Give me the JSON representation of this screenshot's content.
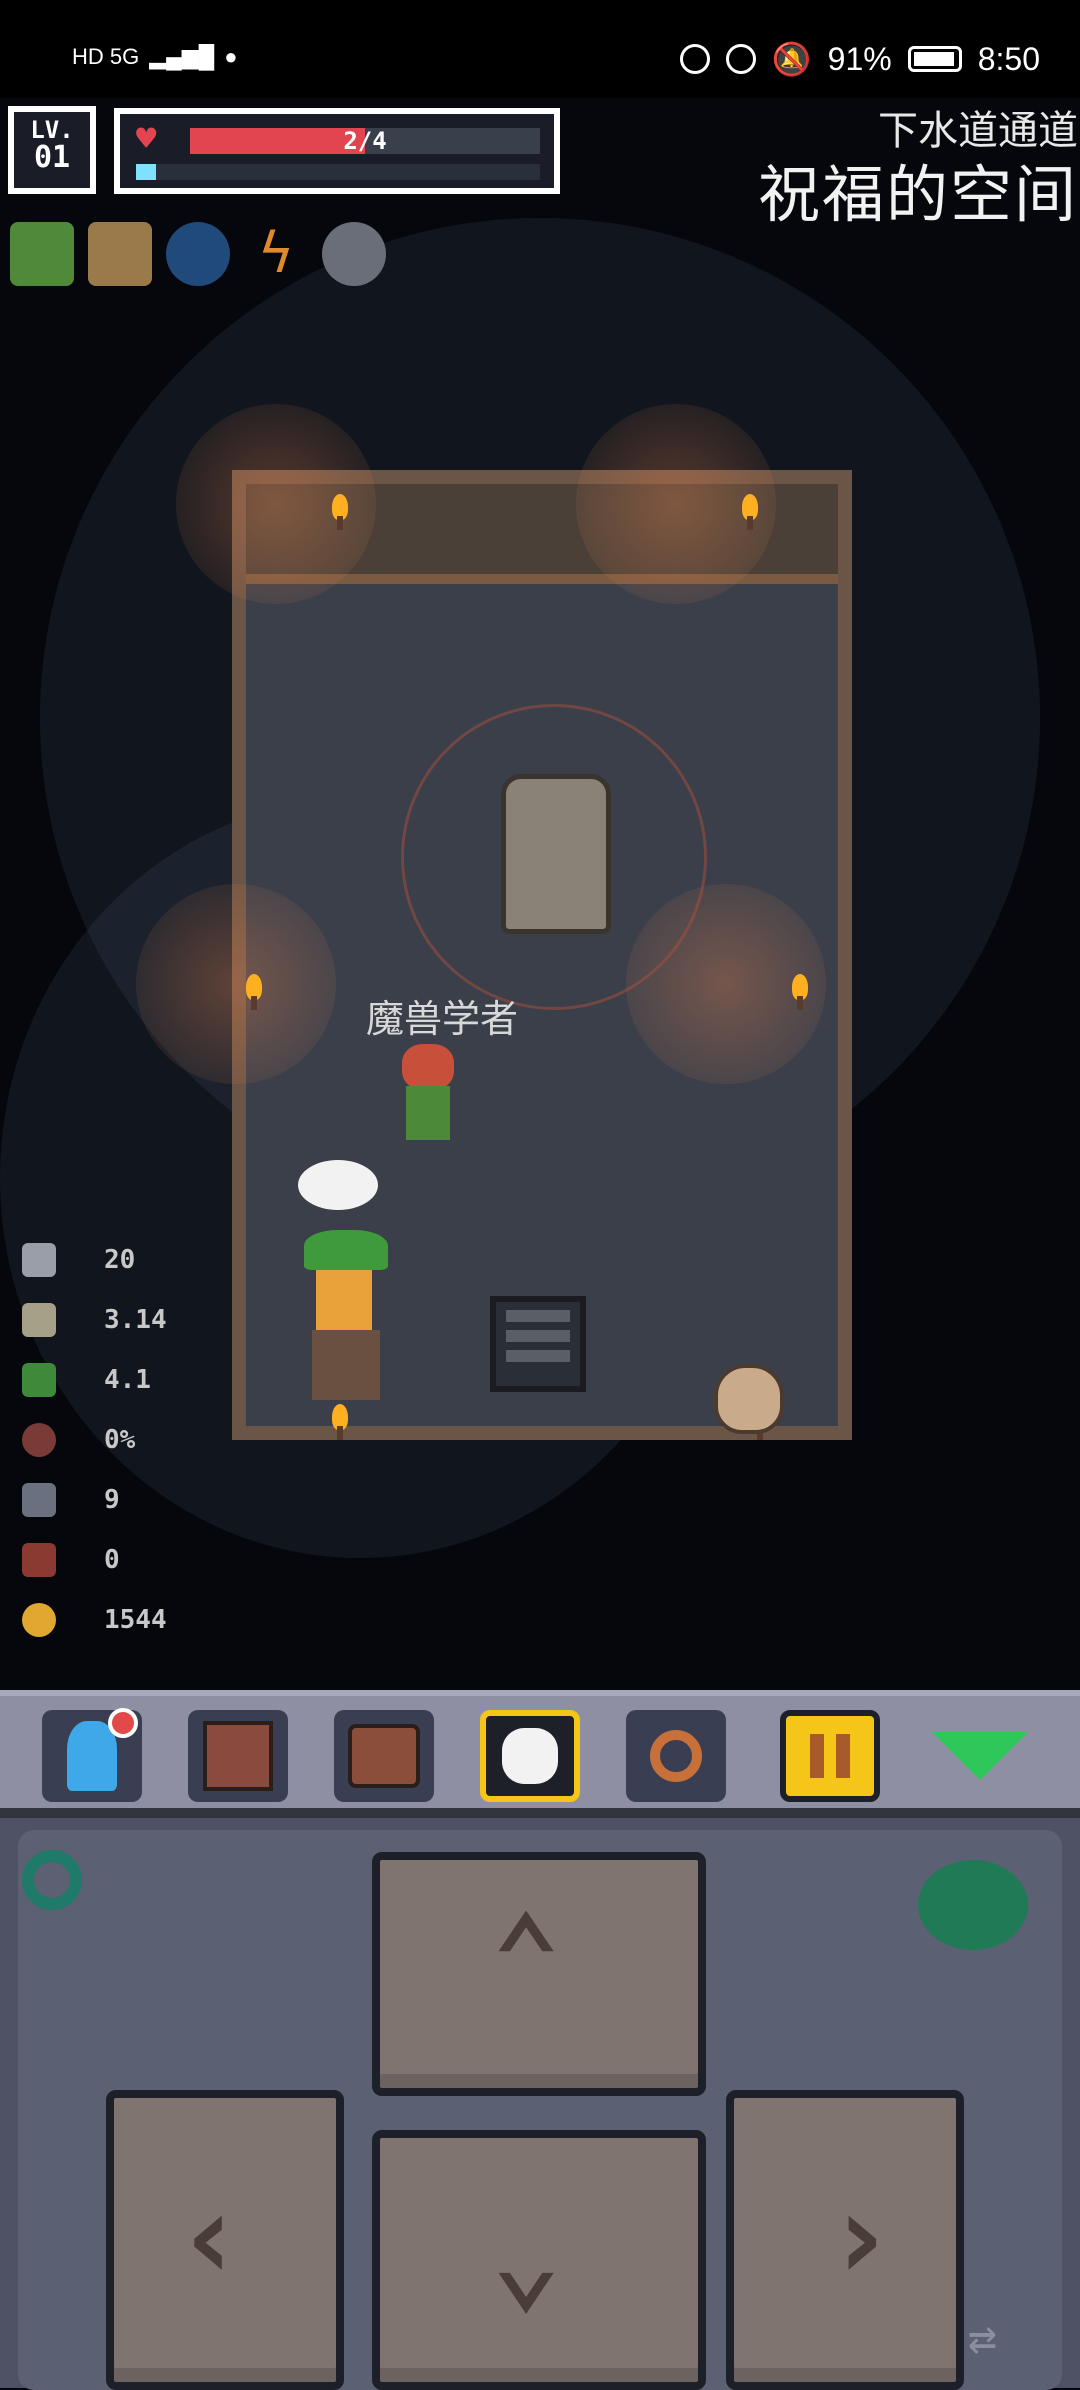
{
  "status_bar": {
    "left": "HD 5G",
    "battery": "91%",
    "time": "8:50"
  },
  "hud": {
    "level_prefix": "LV.",
    "level": "01",
    "hp_text": "2/4",
    "hp_current": 2,
    "hp_max": 4,
    "mana_fraction": 0.05,
    "location_sub": "下水道通道",
    "location_main": "祝福的空间",
    "items": [
      "snake-item-icon",
      "star-bunch-item-icon",
      "blue-orb-item-icon",
      "lightning-item-icon",
      "spoon-item-icon"
    ]
  },
  "room": {
    "npc_name": "魔兽学者"
  },
  "stats": [
    {
      "icon": "sword-icon",
      "value": "20"
    },
    {
      "icon": "attack-speed-icon",
      "value": "3.14"
    },
    {
      "icon": "boot-speed-icon",
      "value": "4.1"
    },
    {
      "icon": "shield-icon",
      "value": "0%"
    },
    {
      "icon": "key-icon",
      "value": "9"
    },
    {
      "icon": "red-key-icon",
      "value": "0"
    },
    {
      "icon": "gold-coin-icon",
      "value": "1544"
    }
  ],
  "toolbar": {
    "buttons": [
      "character-icon",
      "journal-icon",
      "backpack-icon",
      "map-focus-icon",
      "search-icon",
      "pause-icon",
      "collapse-icon"
    ]
  },
  "colors": {
    "hp": "#e24550",
    "mana": "#7fe0ff",
    "dpad": "#7f7470",
    "toolbar": "#8e8fa3",
    "selected": "#f5c518"
  }
}
